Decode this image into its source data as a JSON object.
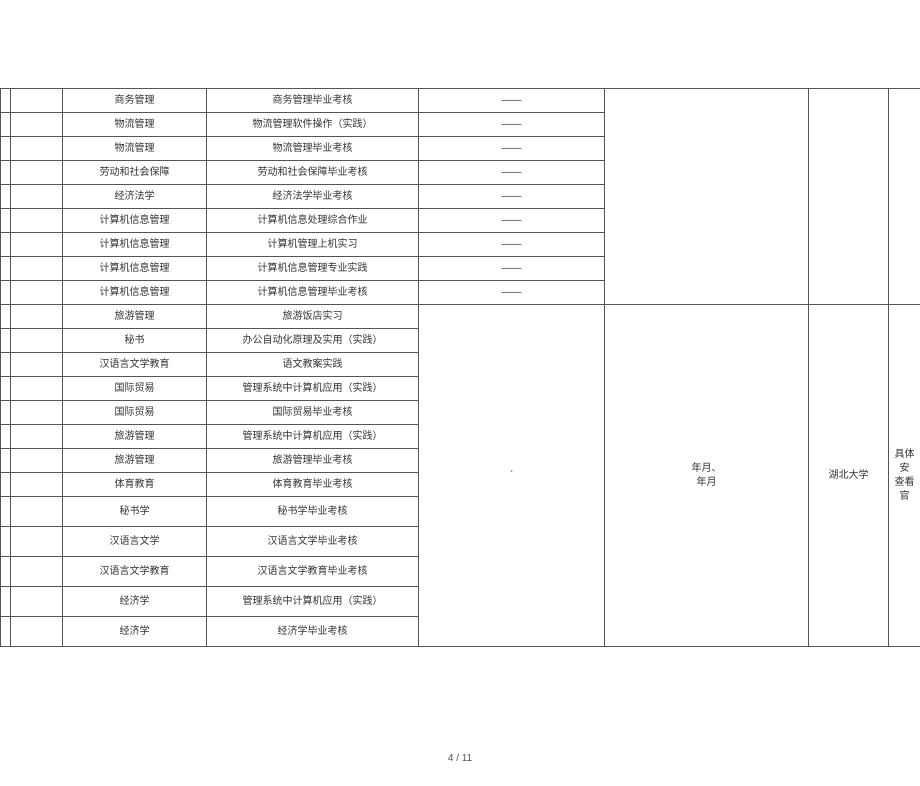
{
  "group1": {
    "rows": [
      {
        "major": "商务管理",
        "subject": "商务管理毕业考核",
        "dash": "——"
      },
      {
        "major": "物流管理",
        "subject": "物流管理软件操作（实践）",
        "dash": "——"
      },
      {
        "major": "物流管理",
        "subject": "物流管理毕业考核",
        "dash": "——"
      },
      {
        "major": "劳动和社会保障",
        "subject": "劳动和社会保障毕业考核",
        "dash": "——"
      },
      {
        "major": "经济法学",
        "subject": "经济法学毕业考核",
        "dash": "——"
      },
      {
        "major": "计算机信息管理",
        "subject": "计算机信息处理综合作业",
        "dash": "——"
      },
      {
        "major": "计算机信息管理",
        "subject": "计算机管理上机实习",
        "dash": "——"
      },
      {
        "major": "计算机信息管理",
        "subject": "计算机信息管理专业实践",
        "dash": "——"
      },
      {
        "major": "计算机信息管理",
        "subject": "计算机信息管理毕业考核",
        "dash": "——"
      }
    ],
    "merged_col5": "",
    "merged_col6": "",
    "merged_col7": ""
  },
  "group2": {
    "rows": [
      {
        "major": "旅游管理",
        "subject": "旅游饭店实习"
      },
      {
        "major": "秘书",
        "subject": "办公自动化原理及实用（实践）"
      },
      {
        "major": "汉语言文学教育",
        "subject": "语文教案实践"
      },
      {
        "major": "国际贸易",
        "subject": "管理系统中计算机应用（实践）"
      },
      {
        "major": "国际贸易",
        "subject": "国际贸易毕业考核"
      },
      {
        "major": "旅游管理",
        "subject": "管理系统中计算机应用（实践）"
      },
      {
        "major": "旅游管理",
        "subject": "旅游管理毕业考核"
      },
      {
        "major": "体育教育",
        "subject": "体育教育毕业考核"
      },
      {
        "major": "秘书学",
        "subject": "秘书学毕业考核"
      },
      {
        "major": "汉语言文学",
        "subject": "汉语言文学毕业考核"
      },
      {
        "major": "汉语言文学教育",
        "subject": "汉语言文学教育毕业考核"
      },
      {
        "major": "经济学",
        "subject": "管理系统中计算机应用（实践）"
      },
      {
        "major": "经济学",
        "subject": "经济学毕业考核"
      }
    ],
    "merged_col4": "`",
    "merged_col5": "年月、\n年月",
    "merged_col6": "湖北大学",
    "merged_col7": "具体安\n查看 官"
  },
  "footer": "4 / 11"
}
